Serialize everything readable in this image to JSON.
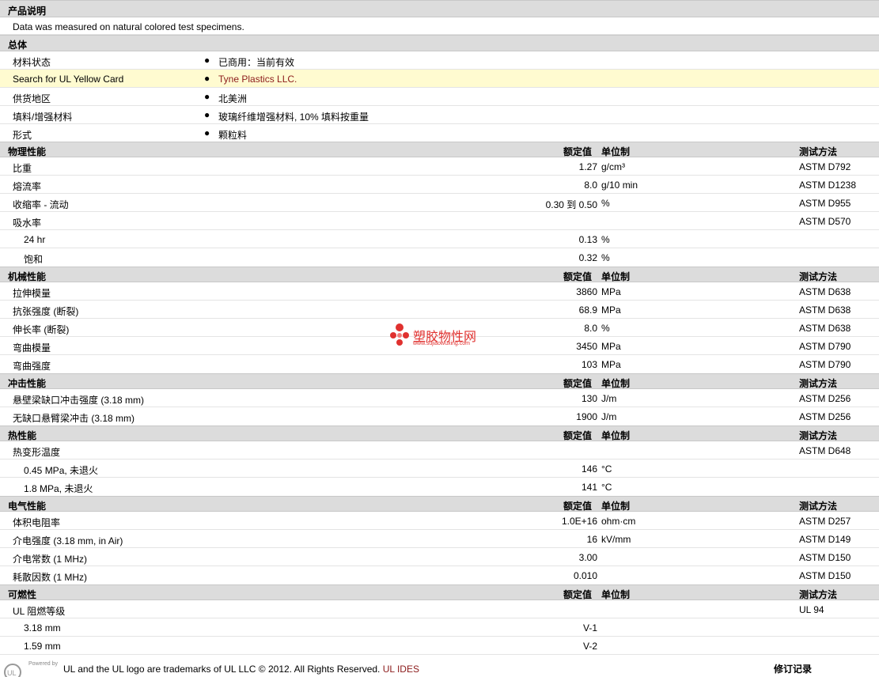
{
  "description": {
    "header": "产品说明",
    "text": "Data was measured on natural colored test specimens."
  },
  "general": {
    "header": "总体",
    "rows": [
      {
        "label": "材料状态",
        "value": "已商用：当前有效"
      },
      {
        "label": "Search for UL Yellow Card",
        "value": "Tyne Plastics LLC."
      },
      {
        "label": "供货地区",
        "value": "北美洲"
      },
      {
        "label": "填料/增强材料",
        "value": "玻璃纤维增强材料, 10% 填料按重量"
      },
      {
        "label": "形式",
        "value": "颗粒料"
      }
    ]
  },
  "columns": {
    "value": "额定值",
    "unit": "单位制",
    "method": "测试方法"
  },
  "physical": {
    "header": "物理性能",
    "rows": [
      {
        "label": "比重",
        "value": "1.27",
        "unit": "g/cm³",
        "method": "ASTM D792"
      },
      {
        "label": "熔流率",
        "value": "8.0",
        "unit": "g/10 min",
        "method": "ASTM D1238"
      },
      {
        "label": "收缩率  - 流动",
        "value": "0.30 到  0.50",
        "unit": "%",
        "method": "ASTM D955"
      },
      {
        "label": "吸水率",
        "value": "",
        "unit": "",
        "method": "ASTM D570"
      },
      {
        "label": "24 hr",
        "value": "0.13",
        "unit": "%",
        "method": ""
      },
      {
        "label": "饱和",
        "value": "0.32",
        "unit": "%",
        "method": ""
      }
    ]
  },
  "mechanical": {
    "header": "机械性能",
    "rows": [
      {
        "label": "拉伸模量",
        "value": "3860",
        "unit": "MPa",
        "method": "ASTM D638"
      },
      {
        "label": "抗张强度  (断裂)",
        "value": "68.9",
        "unit": "MPa",
        "method": "ASTM D638"
      },
      {
        "label": "伸长率  (断裂)",
        "value": "8.0",
        "unit": "%",
        "method": "ASTM D638"
      },
      {
        "label": "弯曲模量",
        "value": "3450",
        "unit": "MPa",
        "method": "ASTM D790"
      },
      {
        "label": "弯曲强度",
        "value": "103",
        "unit": "MPa",
        "method": "ASTM D790"
      }
    ]
  },
  "impact": {
    "header": "冲击性能",
    "rows": [
      {
        "label": "悬壁梁缺口冲击强度  (3.18 mm)",
        "value": "130",
        "unit": "J/m",
        "method": "ASTM D256"
      },
      {
        "label": "无缺口悬臂梁冲击  (3.18 mm)",
        "value": "1900",
        "unit": "J/m",
        "method": "ASTM D256"
      }
    ]
  },
  "thermal": {
    "header": "热性能",
    "rows": [
      {
        "label": "热变形温度",
        "value": "",
        "unit": "",
        "method": "ASTM D648"
      },
      {
        "label": "0.45 MPa, 未退火",
        "value": "146",
        "unit": "°C",
        "method": ""
      },
      {
        "label": "1.8 MPa, 未退火",
        "value": "141",
        "unit": "°C",
        "method": ""
      }
    ]
  },
  "electrical": {
    "header": "电气性能",
    "rows": [
      {
        "label": "体积电阻率",
        "value": "1.0E+16",
        "unit": "ohm·cm",
        "method": "ASTM D257"
      },
      {
        "label": "介电强度  (3.18 mm, in Air)",
        "value": "16",
        "unit": "kV/mm",
        "method": "ASTM D149"
      },
      {
        "label": "介电常数  (1 MHz)",
        "value": "3.00",
        "unit": "",
        "method": "ASTM D150"
      },
      {
        "label": "耗散因数  (1 MHz)",
        "value": "0.010",
        "unit": "",
        "method": "ASTM D150"
      }
    ]
  },
  "flammability": {
    "header": "可燃性",
    "rows": [
      {
        "label": "UL 阻燃等级",
        "value": "",
        "unit": "",
        "method": "UL 94"
      },
      {
        "label": "3.18 mm",
        "value": "V-1",
        "unit": "",
        "method": ""
      },
      {
        "label": "1.59 mm",
        "value": "V-2",
        "unit": "",
        "method": ""
      }
    ]
  },
  "watermark": {
    "title": "塑胶物性网",
    "url": "www.sujiaowuxing.com"
  },
  "footer": {
    "powered_by": "Powered by",
    "text": "UL and the UL logo are trademarks of UL LLC © 2012. All Rights Reserved.",
    "link": "UL IDES",
    "revision": "修订记录"
  }
}
